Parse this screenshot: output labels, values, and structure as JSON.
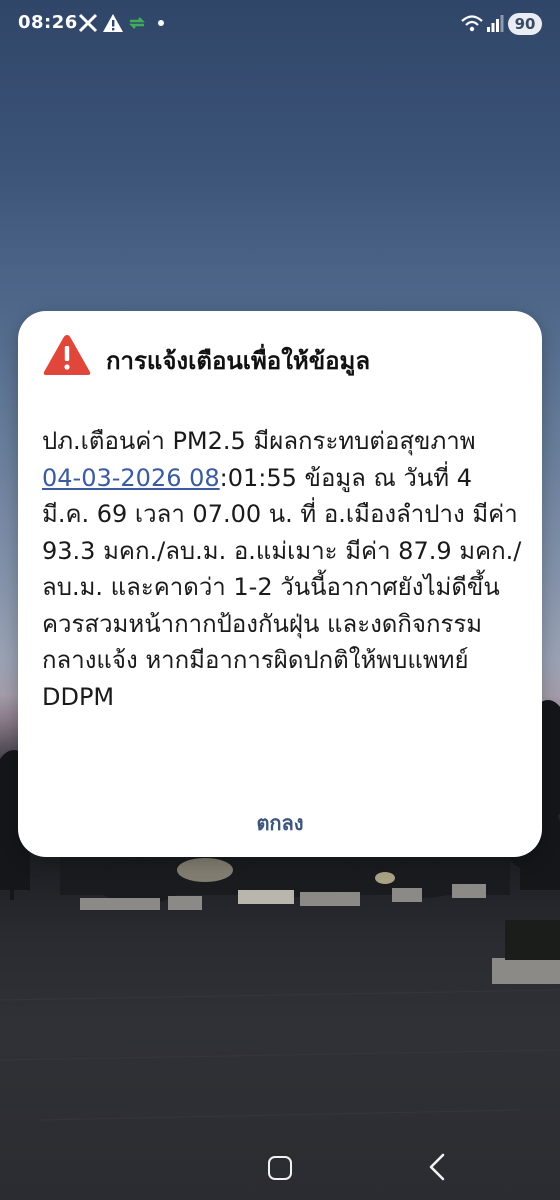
{
  "status_bar": {
    "time": "08:26",
    "battery": "90",
    "icons": [
      "x-logo-icon",
      "warning-notification-icon",
      "data-transfer-icon",
      "dot-icon",
      "wifi-icon",
      "signal-icon",
      "battery-icon"
    ]
  },
  "alert": {
    "icon": "warning-triangle-icon",
    "title": "การแจ้งเตือนเพื่อให้ข้อมูล",
    "body": {
      "part1": "ปภ.เตือนค่า PM2.5 มีผลกระทบต่อสุขภาพ ",
      "link": "04-03-2026 08",
      "part2": ":01:55 ข้อมูล ณ วันที่ 4 มี.ค. 69 เวลา 07.00 น. ที่ อ.เมืองลำปาง มีค่า 93.3 มคก./ลบ.ม. อ.แม่เมาะ มีค่า 87.9 มคก./ลบ.ม. และคาดว่า 1-2 วันนี้อากาศยังไม่ดีขึ้น ควรสวมหน้ากากป้องกันฝุ่น และงดกิจกรรมกลางแจ้ง หากมีอาการผิดปกติให้พบแพทย์ DDPM"
    },
    "ok_label": "ตกลง"
  },
  "colors": {
    "accent": "#3b557d",
    "link": "#3a5ba0",
    "warning": "#e0463a"
  }
}
